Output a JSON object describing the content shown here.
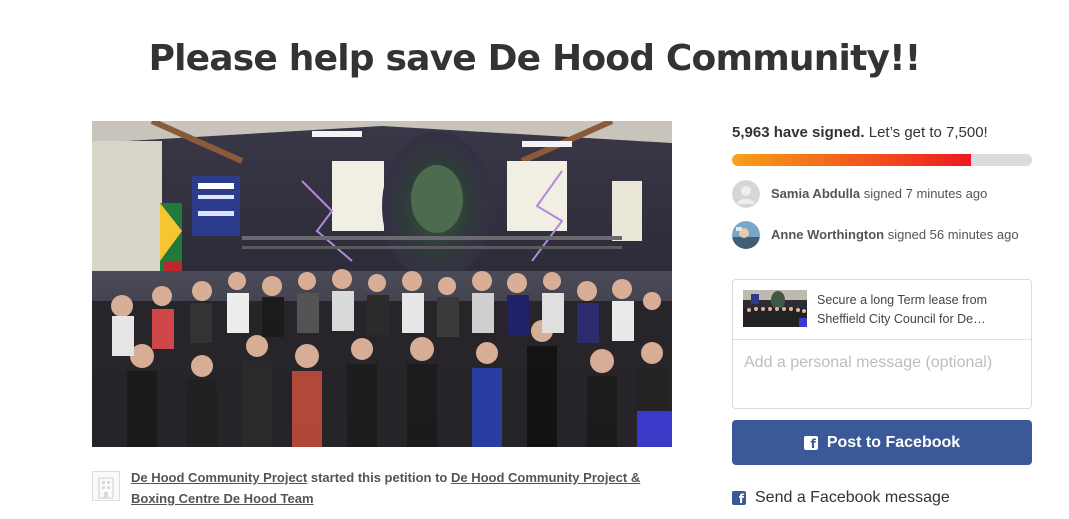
{
  "petition": {
    "title": "Please help save De Hood Community!!",
    "photo_label": "Group photo of boxers at De Hood Community gym"
  },
  "starter": {
    "author": "De Hood Community Project",
    "middle_text": " started this petition to ",
    "target": "De Hood Community Project & Boxing Centre De Hood Team"
  },
  "signatures": {
    "count_text": "5,963 have signed.",
    "goal_text": " Let’s get to 7,500!",
    "progress_fraction": 0.795,
    "progress_colors": [
      "#f9a11a",
      "#ec1b23"
    ]
  },
  "recent_signers": [
    {
      "name": "Samia Abdulla",
      "action": " signed 7 minutes ago",
      "avatar": "default-avatar-icon"
    },
    {
      "name": "Anne Worthington",
      "action": " signed 56 minutes ago",
      "avatar": "photo-avatar"
    }
  ],
  "share_card": {
    "preview_text": "Secure a long Term lease from Sheffield City Council for De…",
    "message_placeholder": "Add a personal message (optional)"
  },
  "actions": {
    "post_facebook": "Post to Facebook",
    "send_facebook_message": "Send a Facebook message",
    "facebook_color": "#3b5998"
  },
  "icons": {
    "facebook": "facebook-icon",
    "building": "building-icon"
  }
}
